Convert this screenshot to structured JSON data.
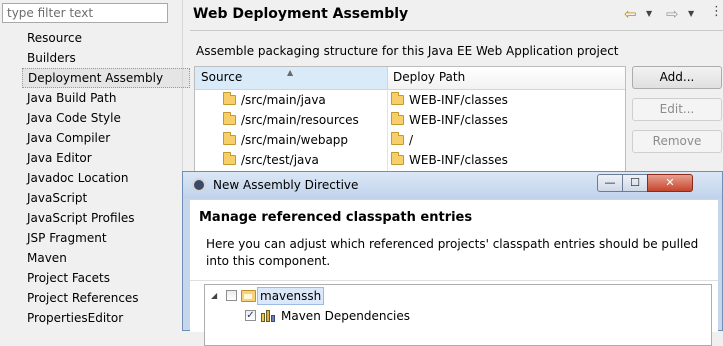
{
  "filter": {
    "placeholder": "type filter text"
  },
  "nav": {
    "items": [
      "Resource",
      "Builders",
      "Deployment Assembly",
      "Java Build Path",
      "Java Code Style",
      "Java Compiler",
      "Java Editor",
      "Javadoc Location",
      "JavaScript",
      "JavaScript Profiles",
      "JSP Fragment",
      "Maven",
      "Project Facets",
      "Project References",
      "PropertiesEditor"
    ],
    "selected": "Deployment Assembly"
  },
  "page": {
    "title": "Web Deployment Assembly",
    "description": "Assemble packaging structure for this Java EE Web Application project",
    "nav_icons": [
      "back-arrow-icon",
      "dropdown-icon",
      "forward-arrow-icon",
      "dropdown-icon"
    ]
  },
  "table": {
    "headers": {
      "source": "Source",
      "deploy": "Deploy Path"
    },
    "rows": [
      {
        "source": "/src/main/java",
        "deploy": "WEB-INF/classes"
      },
      {
        "source": "/src/main/resources",
        "deploy": "WEB-INF/classes"
      },
      {
        "source": "/src/main/webapp",
        "deploy": "/"
      },
      {
        "source": "/src/test/java",
        "deploy": "WEB-INF/classes"
      }
    ]
  },
  "buttons": {
    "add": "Add...",
    "edit": "Edit...",
    "remove": "Remove"
  },
  "dialog": {
    "title": "New Assembly Directive",
    "heading": "Manage referenced classpath entries",
    "description": "Here you can adjust which referenced projects' classpath entries should be pulled into this component.",
    "window_controls": {
      "minimize": "—",
      "maximize": "☐",
      "close": "✕"
    },
    "tree": {
      "project": "mavenssh",
      "children": [
        "Maven Dependencies"
      ]
    }
  }
}
